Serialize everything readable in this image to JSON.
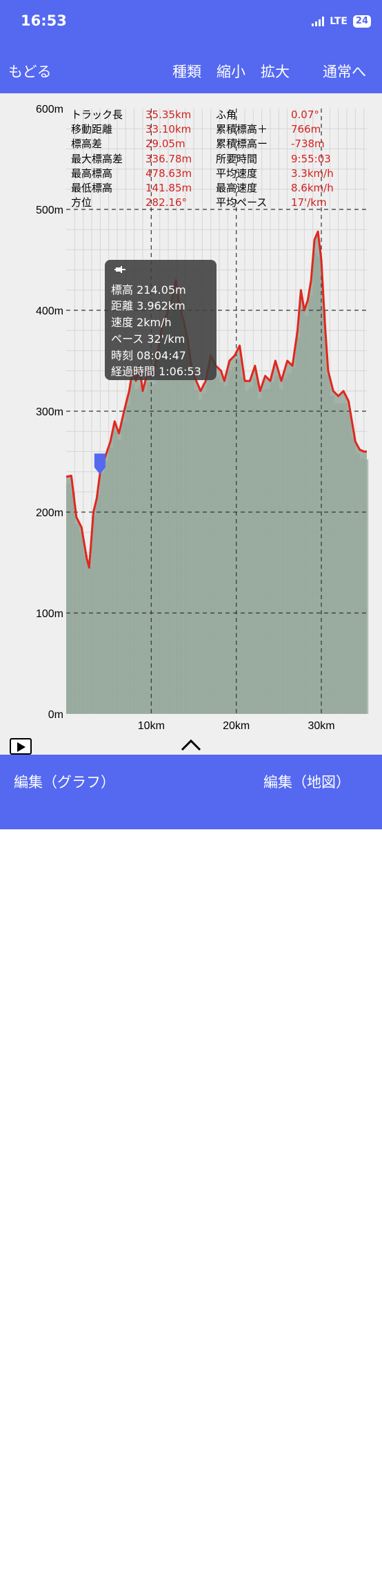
{
  "status": {
    "time": "16:53",
    "network": "LTE",
    "battery": "24"
  },
  "nav": {
    "back": "もどる",
    "type": "種類",
    "zoom_out": "縮小",
    "zoom_in": "拡大",
    "normal": "通常へ"
  },
  "stats": [
    [
      "トラック長",
      "35.35km",
      "ふ角",
      "0.07°"
    ],
    [
      "移動距離",
      "33.10km",
      "累積標高＋",
      "766m"
    ],
    [
      "標高差",
      "29.05m",
      "累積標高ー",
      "-738m"
    ],
    [
      "最大標高差",
      "336.78m",
      "所要時間",
      "9:55:03"
    ],
    [
      "最高標高",
      "478.63m",
      "平均速度",
      "3.3km/h"
    ],
    [
      "最低標高",
      "141.85m",
      "最高速度",
      "8.6km/h"
    ],
    [
      "方位",
      "282.16°",
      "平均ペース",
      "17'/km"
    ]
  ],
  "tooltip": {
    "elevation": "標高 214.05m",
    "distance": "距離 3.962km",
    "speed": "速度 2km/h",
    "pace": "ペース 32'/km",
    "time": "時刻 08:04:47",
    "elapsed": "経過時間 1:06:53"
  },
  "chart_data": {
    "type": "area",
    "x_unit": "km",
    "xlim": [
      0,
      35.35
    ],
    "ylim": [
      0,
      600
    ],
    "y_ticks": [
      "0m",
      "100m",
      "200m",
      "300m",
      "400m",
      "500m",
      "600m"
    ],
    "x_ticks": [
      "10km",
      "20km",
      "30km"
    ],
    "x_tick_values": [
      10,
      20,
      30
    ],
    "grid": true,
    "series": [
      {
        "values_x": [
          0,
          0.6,
          1.2,
          1.8,
          2.4,
          2.7,
          3.2,
          3.6,
          4.0,
          4.6,
          5.2,
          5.7,
          6.2,
          6.8,
          7.4,
          7.8,
          8.2,
          8.6,
          9.0,
          9.6,
          10.2,
          10.8,
          11.2,
          11.8,
          12.4,
          12.9,
          13.3,
          13.8,
          14.3,
          14.8,
          15.3,
          15.8,
          16.4,
          17.0,
          17.6,
          18.2,
          18.6,
          19.2,
          19.8,
          20.4,
          21.0,
          21.6,
          22.2,
          22.8,
          23.4,
          24.0,
          24.6,
          25.3,
          26.0,
          26.6,
          27.2,
          27.6,
          28.0,
          28.4,
          28.8,
          29.2,
          29.6,
          30.0,
          30.4,
          30.8,
          31.4,
          32.0,
          32.6,
          33.2,
          33.6,
          34.0,
          34.5,
          35.0,
          35.35
        ],
        "values_y": [
          235,
          236,
          195,
          185,
          155,
          145,
          200,
          214,
          240,
          255,
          270,
          290,
          278,
          300,
          320,
          340,
          330,
          345,
          320,
          340,
          335,
          360,
          380,
          395,
          410,
          430,
          405,
          390,
          370,
          340,
          330,
          320,
          330,
          355,
          345,
          340,
          330,
          350,
          355,
          365,
          330,
          330,
          345,
          320,
          335,
          330,
          350,
          330,
          350,
          345,
          380,
          420,
          400,
          410,
          430,
          470,
          478,
          450,
          390,
          340,
          320,
          315,
          320,
          310,
          290,
          270,
          262,
          260,
          260
        ]
      }
    ],
    "colors": {
      "line": "#e0271e",
      "fill": "#97a89c",
      "bar": "#7d9182",
      "background": "#efefef",
      "bar_accent": "#5468f0"
    }
  },
  "bottom": {
    "edit_graph": "編集（グラフ）",
    "edit_map": "編集（地図）"
  }
}
